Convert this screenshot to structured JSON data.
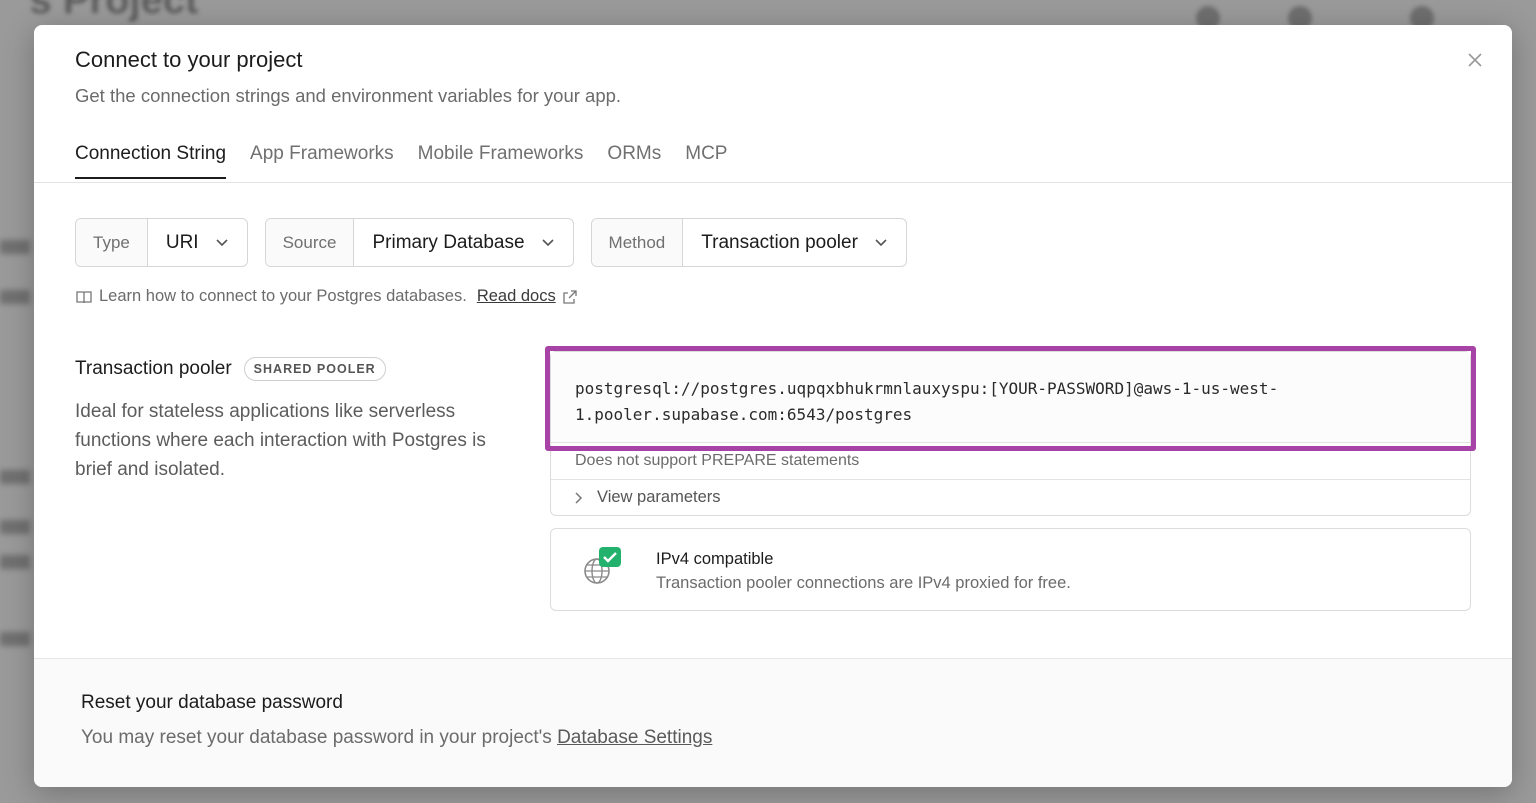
{
  "background": {
    "title": "'s Project"
  },
  "modal": {
    "title": "Connect to your project",
    "subtitle": "Get the connection strings and environment variables for your app.",
    "close_icon": "close-icon"
  },
  "tabs": [
    {
      "label": "Connection String",
      "active": true
    },
    {
      "label": "App Frameworks",
      "active": false
    },
    {
      "label": "Mobile Frameworks",
      "active": false
    },
    {
      "label": "ORMs",
      "active": false
    },
    {
      "label": "MCP",
      "active": false
    }
  ],
  "selectors": {
    "type": {
      "label": "Type",
      "value": "URI"
    },
    "source": {
      "label": "Source",
      "value": "Primary Database"
    },
    "method": {
      "label": "Method",
      "value": "Transaction pooler"
    }
  },
  "docs": {
    "text": "Learn how to connect to your Postgres databases.",
    "link": "Read docs"
  },
  "pooler": {
    "title": "Transaction pooler",
    "badge": "SHARED POOLER",
    "description": "Ideal for stateless applications like serverless functions where each interaction with Postgres is brief and isolated."
  },
  "connection": {
    "line1": "postgresql://postgres.uqpqxbhukrmnlauxyspu:[YOUR-PASSWORD]@aws-1-us-west-",
    "line2": "1.pooler.supabase.com:6543/postgres",
    "note": "Does not support PREPARE statements",
    "view_params": "View parameters"
  },
  "ipv4": {
    "title": "IPv4 compatible",
    "description": "Transaction pooler connections are IPv4 proxied for free.",
    "check_color": "#23b26d"
  },
  "footer": {
    "title": "Reset your database password",
    "text": "You may reset your database password in your project's",
    "link": "Database Settings"
  },
  "colors": {
    "highlight": "#a743a7"
  }
}
